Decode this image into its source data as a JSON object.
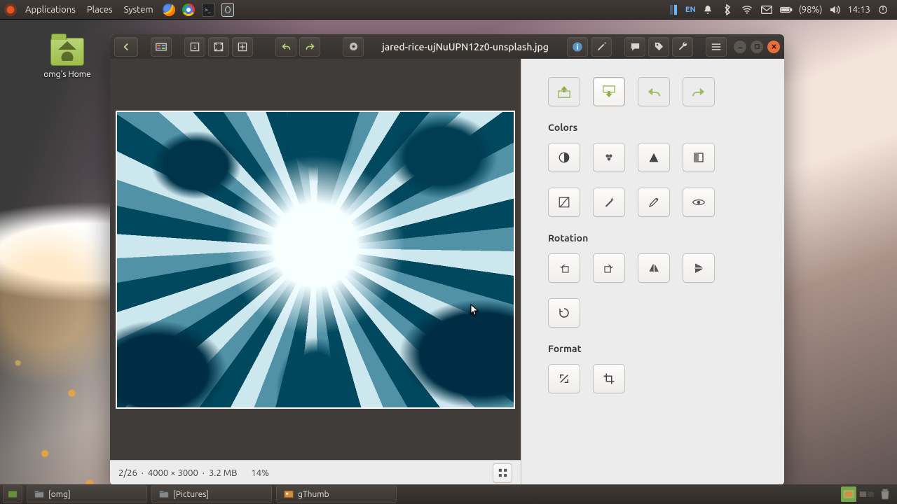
{
  "panel": {
    "applications": "Applications",
    "places": "Places",
    "system": "System",
    "lang": "EN",
    "battery": "(98%)",
    "clock": "14:13"
  },
  "desktop": {
    "home_label": "omg's Home"
  },
  "window": {
    "title": "jared-rice-ujNuUPN12z0-unsplash.jpg"
  },
  "status": {
    "position": "2/26",
    "dimensions": "4000 × 3000",
    "filesize": "3.2 MB",
    "zoom": "14%"
  },
  "side": {
    "colors_title": "Colors",
    "rotation_title": "Rotation",
    "format_title": "Format"
  },
  "taskbar": {
    "item1": "[omg]",
    "item2": "[Pictures]",
    "item3": "gThumb"
  }
}
